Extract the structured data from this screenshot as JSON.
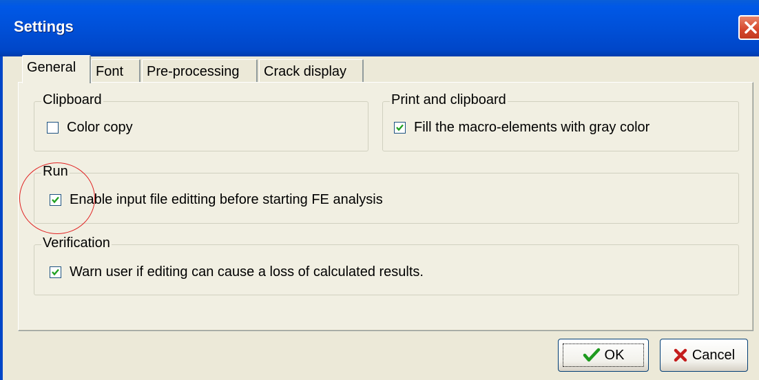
{
  "window": {
    "title": "Settings",
    "close_icon": "close-icon"
  },
  "tabs": [
    {
      "label": "General",
      "active": true
    },
    {
      "label": "Font",
      "active": false
    },
    {
      "label": "Pre-processing",
      "active": false
    },
    {
      "label": "Crack display",
      "active": false
    }
  ],
  "groups": {
    "clipboard": {
      "title": "Clipboard",
      "option": {
        "label": "Color copy",
        "checked": false
      }
    },
    "print_clipboard": {
      "title": "Print and clipboard",
      "option": {
        "label": "Fill the macro-elements with gray color",
        "checked": true
      }
    },
    "run": {
      "title": "Run",
      "option": {
        "label": "Enable input file editting before starting FE analysis",
        "checked": true
      }
    },
    "verification": {
      "title": "Verification",
      "option": {
        "label": "Warn user if editing can cause a loss of calculated results.",
        "checked": true
      }
    }
  },
  "buttons": {
    "ok": {
      "label": "OK",
      "icon": "green-checkmark-icon"
    },
    "cancel": {
      "label": "Cancel",
      "icon": "red-x-icon"
    }
  },
  "colors": {
    "titlebar": "#0050d8",
    "dialog_bg": "#ece9d8",
    "annotation_circle": "#e02020"
  }
}
